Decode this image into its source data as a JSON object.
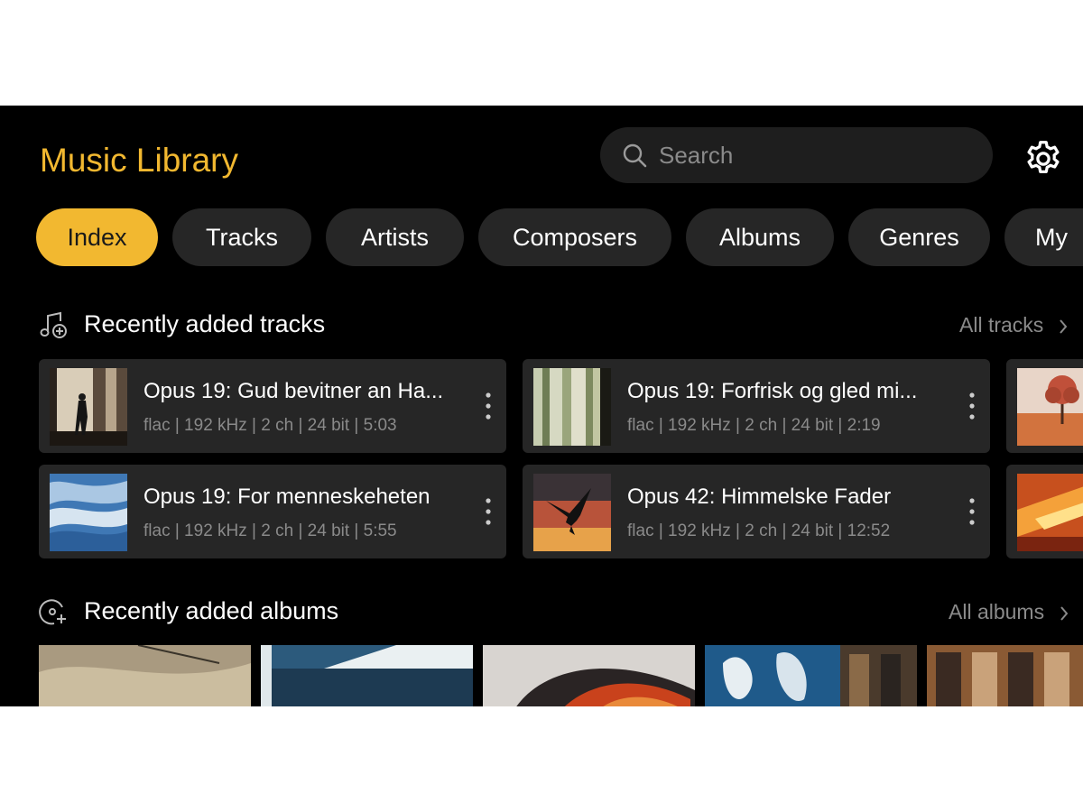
{
  "app": {
    "title": "Music Library"
  },
  "search": {
    "placeholder": "Search",
    "icon": "search-icon"
  },
  "settings": {
    "icon": "gear-icon"
  },
  "tabs": [
    {
      "label": "Index",
      "active": true
    },
    {
      "label": "Tracks",
      "active": false
    },
    {
      "label": "Artists",
      "active": false
    },
    {
      "label": "Composers",
      "active": false
    },
    {
      "label": "Albums",
      "active": false
    },
    {
      "label": "Genres",
      "active": false
    },
    {
      "label": "My",
      "active": false
    }
  ],
  "recent_tracks": {
    "title": "Recently added tracks",
    "link": "All tracks",
    "icon": "music-note-add-icon",
    "items": [
      {
        "title": "Opus 19: Gud bevitner an Ha...",
        "meta": "flac | 192 kHz | 2 ch | 24 bit | 5:03"
      },
      {
        "title": "Opus 19: Forfrisk og gled mi...",
        "meta": "flac | 192 kHz | 2 ch | 24 bit | 2:19"
      },
      {
        "title": "Opus 19: For menneskeheten",
        "meta": "flac | 192 kHz | 2 ch | 24 bit | 5:55"
      },
      {
        "title": "Opus 42: Himmelske Fader",
        "meta": "flac | 192 kHz | 2 ch | 24 bit | 12:52"
      }
    ]
  },
  "recent_albums": {
    "title": "Recently added albums",
    "link": "All albums",
    "icon": "disc-add-icon"
  },
  "colors": {
    "accent": "#f2b830",
    "background": "#000000",
    "card": "#262626",
    "muted": "#8a8a8a"
  }
}
